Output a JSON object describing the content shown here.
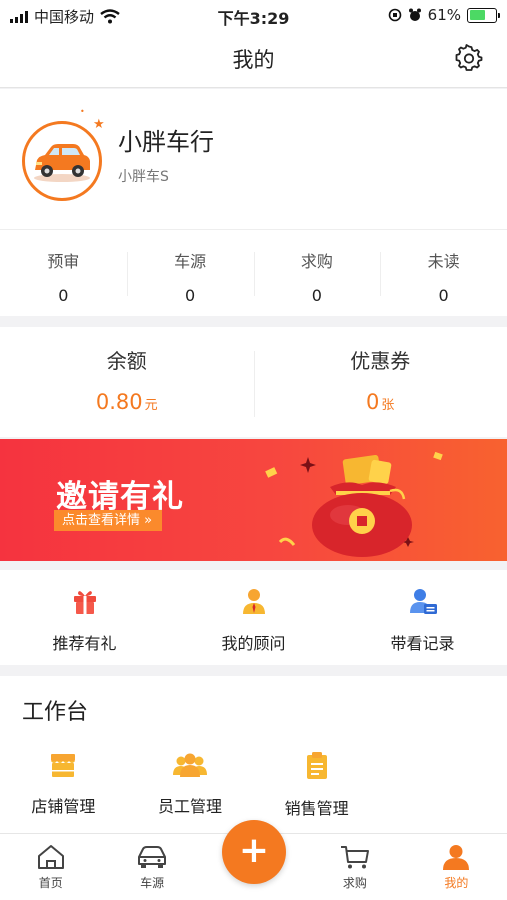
{
  "status_bar": {
    "carrier": "中国移动",
    "time": "下午3:29",
    "battery_pct": "61%",
    "battery_level": 0.61
  },
  "nav": {
    "title": "我的",
    "settings_icon": "gear-icon"
  },
  "profile": {
    "name": "小胖车行",
    "subtitle": "小胖车S",
    "avatar_icon": "car-avatar"
  },
  "stats": [
    {
      "label": "预审",
      "value": "0"
    },
    {
      "label": "车源",
      "value": "0"
    },
    {
      "label": "求购",
      "value": "0"
    },
    {
      "label": "未读",
      "value": "0"
    }
  ],
  "wallet": {
    "balance_label": "余额",
    "balance_value": "0.80",
    "balance_unit": "元",
    "coupon_label": "优惠券",
    "coupon_value": "0",
    "coupon_unit": "张"
  },
  "banner": {
    "title": "邀请有礼",
    "subtitle": "点击查看详情 »"
  },
  "quick_actions": [
    {
      "label": "推荐有礼",
      "icon": "gift-icon"
    },
    {
      "label": "我的顾问",
      "icon": "advisor-icon"
    },
    {
      "label": "带看记录",
      "icon": "viewing-record-icon"
    }
  ],
  "workbench": {
    "title": "工作台",
    "items": [
      {
        "label": "店铺管理",
        "icon": "store-icon"
      },
      {
        "label": "员工管理",
        "icon": "staff-icon"
      },
      {
        "label": "销售管理",
        "icon": "clipboard-icon"
      }
    ]
  },
  "tabbar": {
    "items": [
      {
        "label": "首页",
        "icon": "home-icon"
      },
      {
        "label": "车源",
        "icon": "car-icon"
      },
      {
        "label": "求购",
        "icon": "cart-icon"
      },
      {
        "label": "我的",
        "icon": "user-icon",
        "active": true
      }
    ],
    "fab_label": "+"
  },
  "colors": {
    "accent": "#f47920",
    "banner": "#f5333f",
    "advisor_blue": "#3f7ee6"
  }
}
